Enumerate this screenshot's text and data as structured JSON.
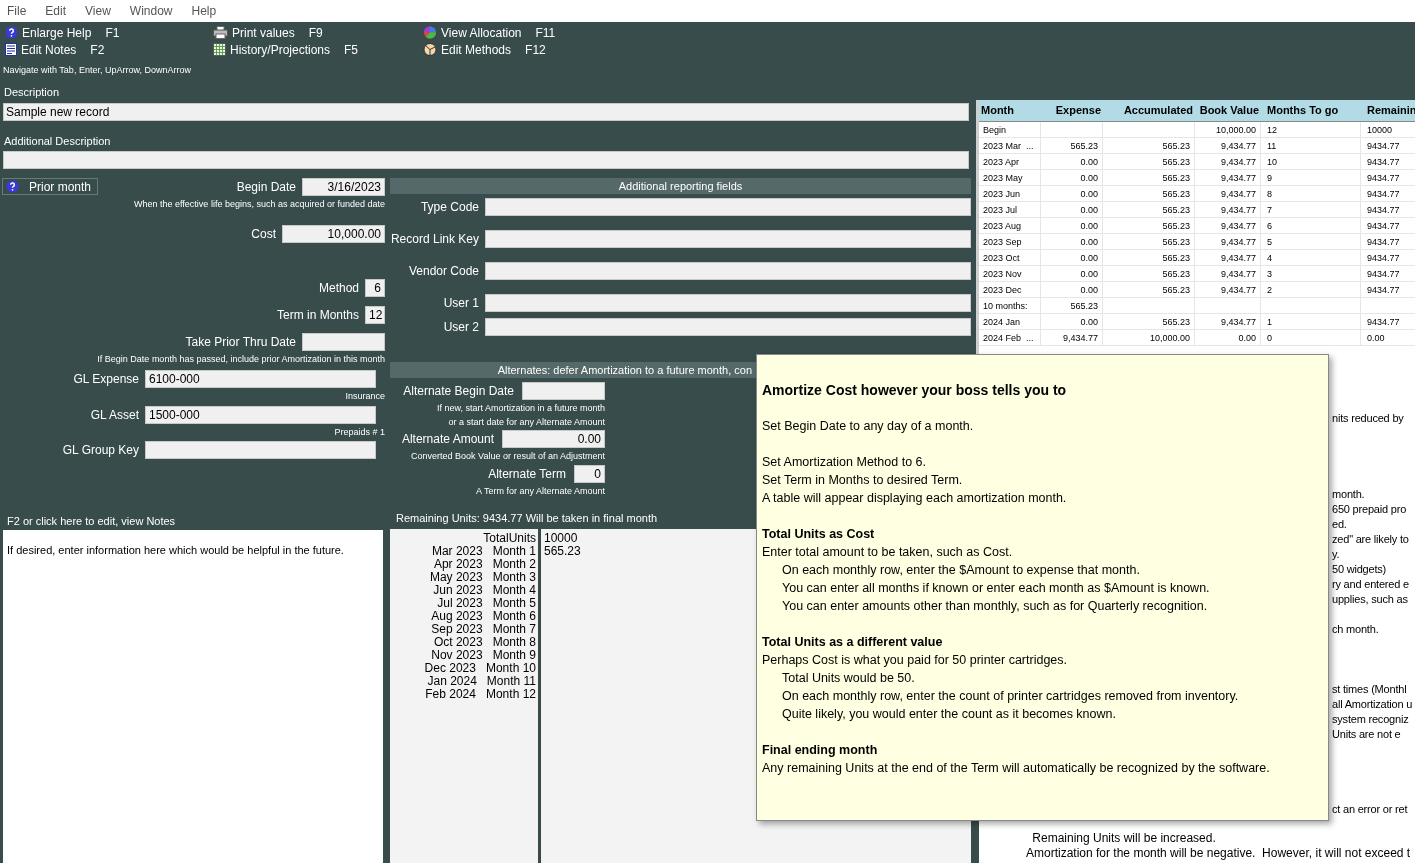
{
  "menu": [
    "File",
    "Edit",
    "View",
    "Window",
    "Help"
  ],
  "toolbar": [
    {
      "kind": "help",
      "label": "Enlarge Help",
      "key": "F1"
    },
    {
      "kind": "notes",
      "label": "Edit Notes",
      "key": "F2"
    },
    {
      "kind": "print",
      "label": "Print values",
      "key": "F9"
    },
    {
      "kind": "grid",
      "label": "History/Projections",
      "key": "F5"
    },
    {
      "kind": "pie",
      "label": "View Allocation",
      "key": "F11"
    },
    {
      "kind": "methods",
      "label": "Edit Methods",
      "key": "F12"
    }
  ],
  "hint": "Navigate with Tab, Enter, UpArrow, DownArrow",
  "description": {
    "label": "Description",
    "value": "Sample new record"
  },
  "additional_description": {
    "label": "Additional Description"
  },
  "prior_month_button": "Prior month",
  "form": [
    {
      "kind": "date",
      "label": "Begin Date",
      "value": "3/16/2023",
      "note": "When the effective life begins, such as acquired or funded date"
    },
    {
      "kind": "amount",
      "label": "Cost",
      "value": "10,000.00"
    },
    {
      "kind": "number",
      "label": "Method",
      "value": "6"
    },
    {
      "kind": "number",
      "label": "Term in Months",
      "value": "12"
    },
    {
      "kind": "date",
      "label": "Take Prior Thru Date",
      "note": "If Begin Date month has passed, include prior Amortization in this month"
    },
    {
      "kind": "account",
      "label": "GL Expense",
      "value": "6100-000",
      "note": "Insurance"
    },
    {
      "kind": "account",
      "label": "GL Asset",
      "value": "1500-000",
      "note": "Prepaids # 1"
    },
    {
      "kind": "account",
      "label": "GL Group Key"
    }
  ],
  "notes": {
    "label": "F2 or click here to edit, view Notes",
    "text": "If desired, enter information here which would be helpful in the future."
  },
  "reporting": {
    "header": "Additional reporting fields",
    "fields": [
      "Type Code",
      "Record Link Key",
      "Vendor Code",
      "User 1",
      "User 2"
    ]
  },
  "alternates": {
    "header": "Alternates: defer Amortization to a future month, con",
    "fields": [
      {
        "kind": "date",
        "label": "Alternate Begin Date",
        "note": "If new, start Amortization in a future month",
        "note2": "or a start date for any Alternate Amount"
      },
      {
        "kind": "amount",
        "label": "Alternate Amount",
        "value": "0.00",
        "note": "Converted Book Value or result of an Adjustment"
      },
      {
        "kind": "number",
        "label": "Alternate Term",
        "value": "0",
        "note": "A Term for any Alternate Amount"
      }
    ]
  },
  "remaining_units": "Remaining Units: 9434.77 Will be taken in final month",
  "units": {
    "total_label": "TotalUnits",
    "values": [
      "10000",
      "565.23"
    ],
    "rows": [
      {
        "date": "Mar 2023",
        "month": "Month 1"
      },
      {
        "date": "Apr 2023",
        "month": "Month 2"
      },
      {
        "date": "May 2023",
        "month": "Month 3"
      },
      {
        "date": "Jun 2023",
        "month": "Month 4"
      },
      {
        "date": "Jul 2023",
        "month": "Month 5"
      },
      {
        "date": "Aug 2023",
        "month": "Month 6"
      },
      {
        "date": "Sep 2023",
        "month": "Month 7"
      },
      {
        "date": "Oct 2023",
        "month": "Month 8"
      },
      {
        "date": "Nov 2023",
        "month": "Month 9"
      },
      {
        "date": "Dec 2023",
        "month": "Month 10"
      },
      {
        "date": "Jan 2024",
        "month": "Month 11"
      },
      {
        "date": "Feb 2024",
        "month": "Month 12"
      }
    ]
  },
  "table": {
    "columns": [
      "Month",
      "Expense",
      "Accumulated",
      "Book Value",
      "Months To go",
      "Remainin"
    ],
    "rows": [
      [
        "Begin",
        "",
        "",
        "10,000.00",
        "12",
        "10000"
      ],
      [
        "2023 Mar  ...",
        "565.23",
        "565.23",
        "9,434.77",
        "11",
        "9434.77"
      ],
      [
        "2023 Apr",
        "0.00",
        "565.23",
        "9,434.77",
        "10",
        "9434.77"
      ],
      [
        "2023 May",
        "0.00",
        "565.23",
        "9,434.77",
        "9",
        "9434.77"
      ],
      [
        "2023 Jun",
        "0.00",
        "565.23",
        "9,434.77",
        "8",
        "9434.77"
      ],
      [
        "2023 Jul",
        "0.00",
        "565.23",
        "9,434.77",
        "7",
        "9434.77"
      ],
      [
        "2023 Aug",
        "0.00",
        "565.23",
        "9,434.77",
        "6",
        "9434.77"
      ],
      [
        "2023 Sep",
        "0.00",
        "565.23",
        "9,434.77",
        "5",
        "9434.77"
      ],
      [
        "2023 Oct",
        "0.00",
        "565.23",
        "9,434.77",
        "4",
        "9434.77"
      ],
      [
        "2023 Nov",
        "0.00",
        "565.23",
        "9,434.77",
        "3",
        "9434.77"
      ],
      [
        "2023 Dec",
        "0.00",
        "565.23",
        "9,434.77",
        "2",
        "9434.77"
      ],
      [
        "10 months:",
        "565.23",
        "",
        "",
        "",
        ""
      ],
      [
        "2024 Jan",
        "0.00",
        "565.23",
        "9,434.77",
        "1",
        "9434.77"
      ],
      [
        "2024 Feb  ...",
        "9,434.77",
        "10,000.00",
        "0.00",
        "0",
        "0.00"
      ]
    ]
  },
  "help_fragments": [
    [
      "nits reduced by"
    ],
    [
      "month.",
      "650 prepaid pro",
      "ed.",
      "zed\" are likely to",
      "y.",
      "50 widgets)",
      "ry and entered e",
      "upplies, such as"
    ],
    [
      "ch month."
    ],
    [
      "st times (Monthl",
      "all Amortization u",
      "system recogniz",
      "Units are not e"
    ],
    [
      "ct an error or ret"
    ]
  ],
  "help_bottom": [
    " Remaining Units will be increased.",
    "Amortization for the month will be negative.  However, it will not exceed t"
  ],
  "tooltip": {
    "title": "Amortize Cost however your boss tells you to",
    "sections": [
      {
        "lines": [
          {
            "text": "Set Begin Date to any day of a month."
          }
        ]
      },
      {
        "lines": [
          {
            "text": "Set Amortization Method to 6."
          },
          {
            "text": "Set Term in Months to desired Term."
          },
          {
            "text": "A table will appear displaying each amortization month."
          }
        ]
      },
      {
        "heading": "Total Units as Cost",
        "lines": [
          {
            "text": "Enter total amount to be taken, such as Cost.",
            "children": [
              {
                "text": "On each monthly row, enter the $Amount to expense that month."
              },
              {
                "text": "You can enter all months if known or enter each month as $Amount is known."
              },
              {
                "text": "You can enter amounts other than monthly, such as for Quarterly recognition."
              }
            ]
          }
        ]
      },
      {
        "heading": "Total Units as a different value",
        "lines": [
          {
            "text": "Perhaps Cost is what you paid for 50 printer cartridges.",
            "children": [
              {
                "text": "Total Units would be 50."
              },
              {
                "text": "On each monthly row, enter the count of printer cartridges removed from inventory."
              },
              {
                "text": "Quite likely, you would enter the count as it becomes known."
              }
            ]
          }
        ]
      },
      {
        "heading": "Final ending month",
        "lines": [
          {
            "text": "Any remaining Units at the end of the Term will automatically be recognized by the software."
          }
        ]
      }
    ]
  }
}
